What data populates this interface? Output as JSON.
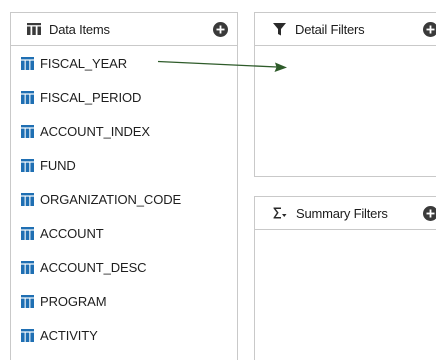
{
  "data_items": {
    "title": "Data Items",
    "add_label": "+",
    "items": [
      {
        "label": "FISCAL_YEAR"
      },
      {
        "label": "FISCAL_PERIOD"
      },
      {
        "label": "ACCOUNT_INDEX"
      },
      {
        "label": "FUND"
      },
      {
        "label": "ORGANIZATION_CODE"
      },
      {
        "label": "ACCOUNT"
      },
      {
        "label": "ACCOUNT_DESC"
      },
      {
        "label": "PROGRAM"
      },
      {
        "label": "ACTIVITY"
      }
    ]
  },
  "detail_filters": {
    "title": "Detail Filters",
    "icon": "filter-funnel-icon"
  },
  "summary_filters": {
    "title": "Summary Filters",
    "icon": "sigma-filter-icon"
  },
  "colors": {
    "column_icon": "#1f6fb3",
    "arrow": "#2e5b2a",
    "border": "#c9c9c9"
  }
}
